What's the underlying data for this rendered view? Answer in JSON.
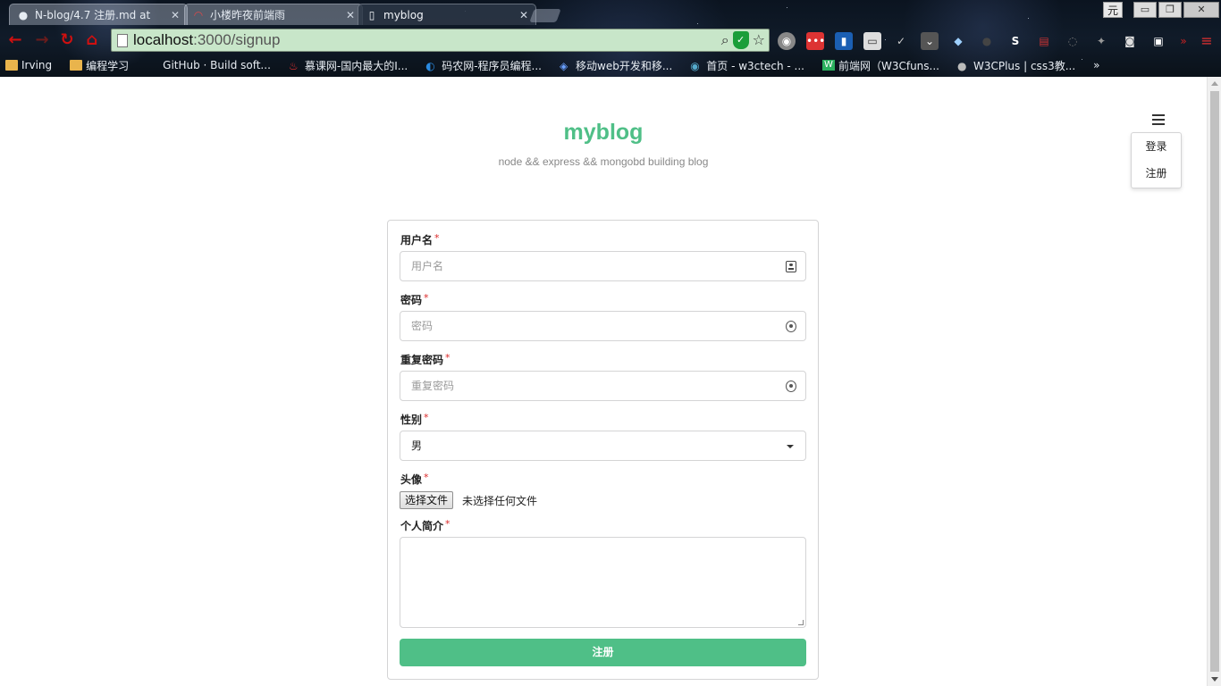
{
  "browser": {
    "tabs": [
      {
        "title": "N-blog/4.7 注册.md at",
        "icon": "github-icon"
      },
      {
        "title": "小楼昨夜前端雨",
        "icon": "site-icon"
      },
      {
        "title": "myblog",
        "icon": "page-icon"
      }
    ],
    "ime_label": "元",
    "url_host": "localhost",
    "url_path": ":3000/signup",
    "bookmarks": [
      {
        "label": "Irving",
        "icon": "folder-icon"
      },
      {
        "label": "编程学习",
        "icon": "folder-icon"
      },
      {
        "label": "GitHub · Build soft...",
        "icon": "github-icon"
      },
      {
        "label": "慕课网-国内最大的I...",
        "icon": "flame-icon"
      },
      {
        "label": "码农网-程序员编程...",
        "icon": "site-icon"
      },
      {
        "label": "移动web开发和移...",
        "icon": "site-icon"
      },
      {
        "label": "首页 - w3ctech - ...",
        "icon": "site-icon"
      },
      {
        "label": "前端网（W3Cfuns...",
        "icon": "site-icon"
      },
      {
        "label": "W3CPlus | css3教...",
        "icon": "site-icon"
      }
    ]
  },
  "header": {
    "title": "myblog",
    "subtitle": "node && express && mongobd building blog"
  },
  "menu": {
    "items": [
      "登录",
      "注册"
    ]
  },
  "form": {
    "username": {
      "label": "用户名",
      "placeholder": "用户名"
    },
    "password": {
      "label": "密码",
      "placeholder": "密码"
    },
    "repassword": {
      "label": "重复密码",
      "placeholder": "重复密码"
    },
    "gender": {
      "label": "性别",
      "value": "男"
    },
    "avatar": {
      "label": "头像",
      "button": "选择文件",
      "status": "未选择任何文件"
    },
    "bio": {
      "label": "个人简介"
    },
    "required_mark": "*",
    "submit": "注册"
  },
  "colors": {
    "accent": "#4fbf87",
    "required": "#db2828"
  }
}
